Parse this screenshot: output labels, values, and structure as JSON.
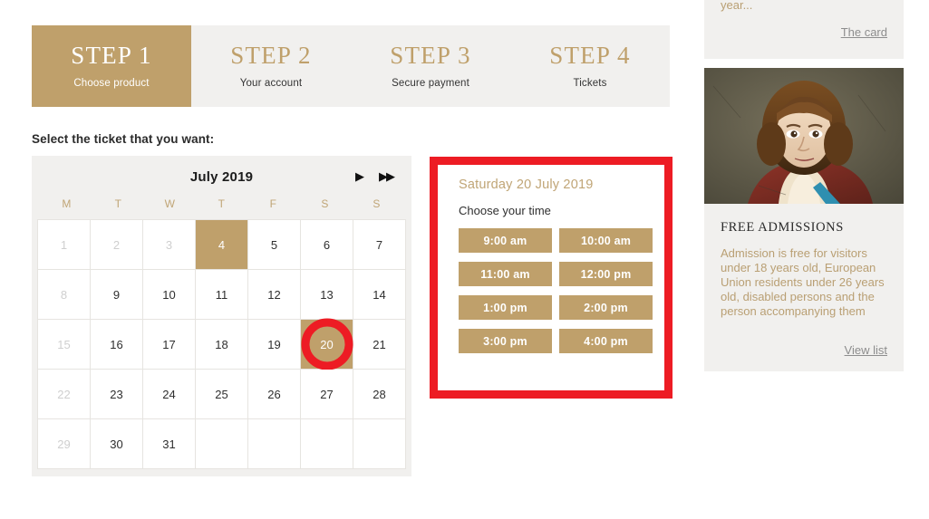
{
  "steps": [
    {
      "title": "STEP 1",
      "subtitle": "Choose product",
      "active": true
    },
    {
      "title": "STEP 2",
      "subtitle": "Your account",
      "active": false
    },
    {
      "title": "STEP 3",
      "subtitle": "Secure payment",
      "active": false
    },
    {
      "title": "STEP 4",
      "subtitle": "Tickets",
      "active": false
    }
  ],
  "section": {
    "label": "Select the ticket that you want:"
  },
  "calendar": {
    "month_label": "July 2019",
    "next_icon": "▶",
    "next_year_icon": "▶▶",
    "weekdays": [
      "M",
      "T",
      "W",
      "T",
      "F",
      "S",
      "S"
    ],
    "weeks": [
      [
        {
          "day": "1",
          "state": "muted"
        },
        {
          "day": "2",
          "state": "muted"
        },
        {
          "day": "3",
          "state": "muted"
        },
        {
          "day": "4",
          "state": "available-highlight"
        },
        {
          "day": "5",
          "state": "normal"
        },
        {
          "day": "6",
          "state": "normal"
        },
        {
          "day": "7",
          "state": "normal"
        }
      ],
      [
        {
          "day": "8",
          "state": "muted"
        },
        {
          "day": "9",
          "state": "normal"
        },
        {
          "day": "10",
          "state": "normal"
        },
        {
          "day": "11",
          "state": "normal"
        },
        {
          "day": "12",
          "state": "normal"
        },
        {
          "day": "13",
          "state": "normal"
        },
        {
          "day": "14",
          "state": "normal"
        }
      ],
      [
        {
          "day": "15",
          "state": "muted"
        },
        {
          "day": "16",
          "state": "normal"
        },
        {
          "day": "17",
          "state": "normal"
        },
        {
          "day": "18",
          "state": "normal"
        },
        {
          "day": "19",
          "state": "normal"
        },
        {
          "day": "20",
          "state": "selected-circled"
        },
        {
          "day": "21",
          "state": "normal"
        }
      ],
      [
        {
          "day": "22",
          "state": "muted"
        },
        {
          "day": "23",
          "state": "normal"
        },
        {
          "day": "24",
          "state": "normal"
        },
        {
          "day": "25",
          "state": "normal"
        },
        {
          "day": "26",
          "state": "normal"
        },
        {
          "day": "27",
          "state": "normal"
        },
        {
          "day": "28",
          "state": "normal"
        }
      ],
      [
        {
          "day": "29",
          "state": "muted"
        },
        {
          "day": "30",
          "state": "normal"
        },
        {
          "day": "31",
          "state": "normal"
        },
        {
          "day": "",
          "state": "empty"
        },
        {
          "day": "",
          "state": "empty"
        },
        {
          "day": "",
          "state": "empty"
        },
        {
          "day": "",
          "state": "empty"
        }
      ]
    ]
  },
  "time_panel": {
    "date_label": "Saturday 20 July 2019",
    "prompt": "Choose your time",
    "slots": [
      "9:00 am",
      "10:00 am",
      "11:00 am",
      "12:00 pm",
      "1:00 pm",
      "2:00 pm",
      "3:00 pm",
      "4:00 pm"
    ]
  },
  "sidebar": {
    "card_teaser": "year...",
    "card_link": "The card",
    "admissions_title": "FREE ADMISSIONS",
    "admissions_body": "Admission is free for visitors under 18 years old, European Union residents under 26 years old, disabled persons and the person accompanying them",
    "admissions_link": "View list"
  },
  "colors": {
    "accent_tan": "#bfa06b",
    "panel_gray": "#f1f0ee",
    "highlight_red": "#ed1c24",
    "muted_text": "#cfcfcf"
  }
}
